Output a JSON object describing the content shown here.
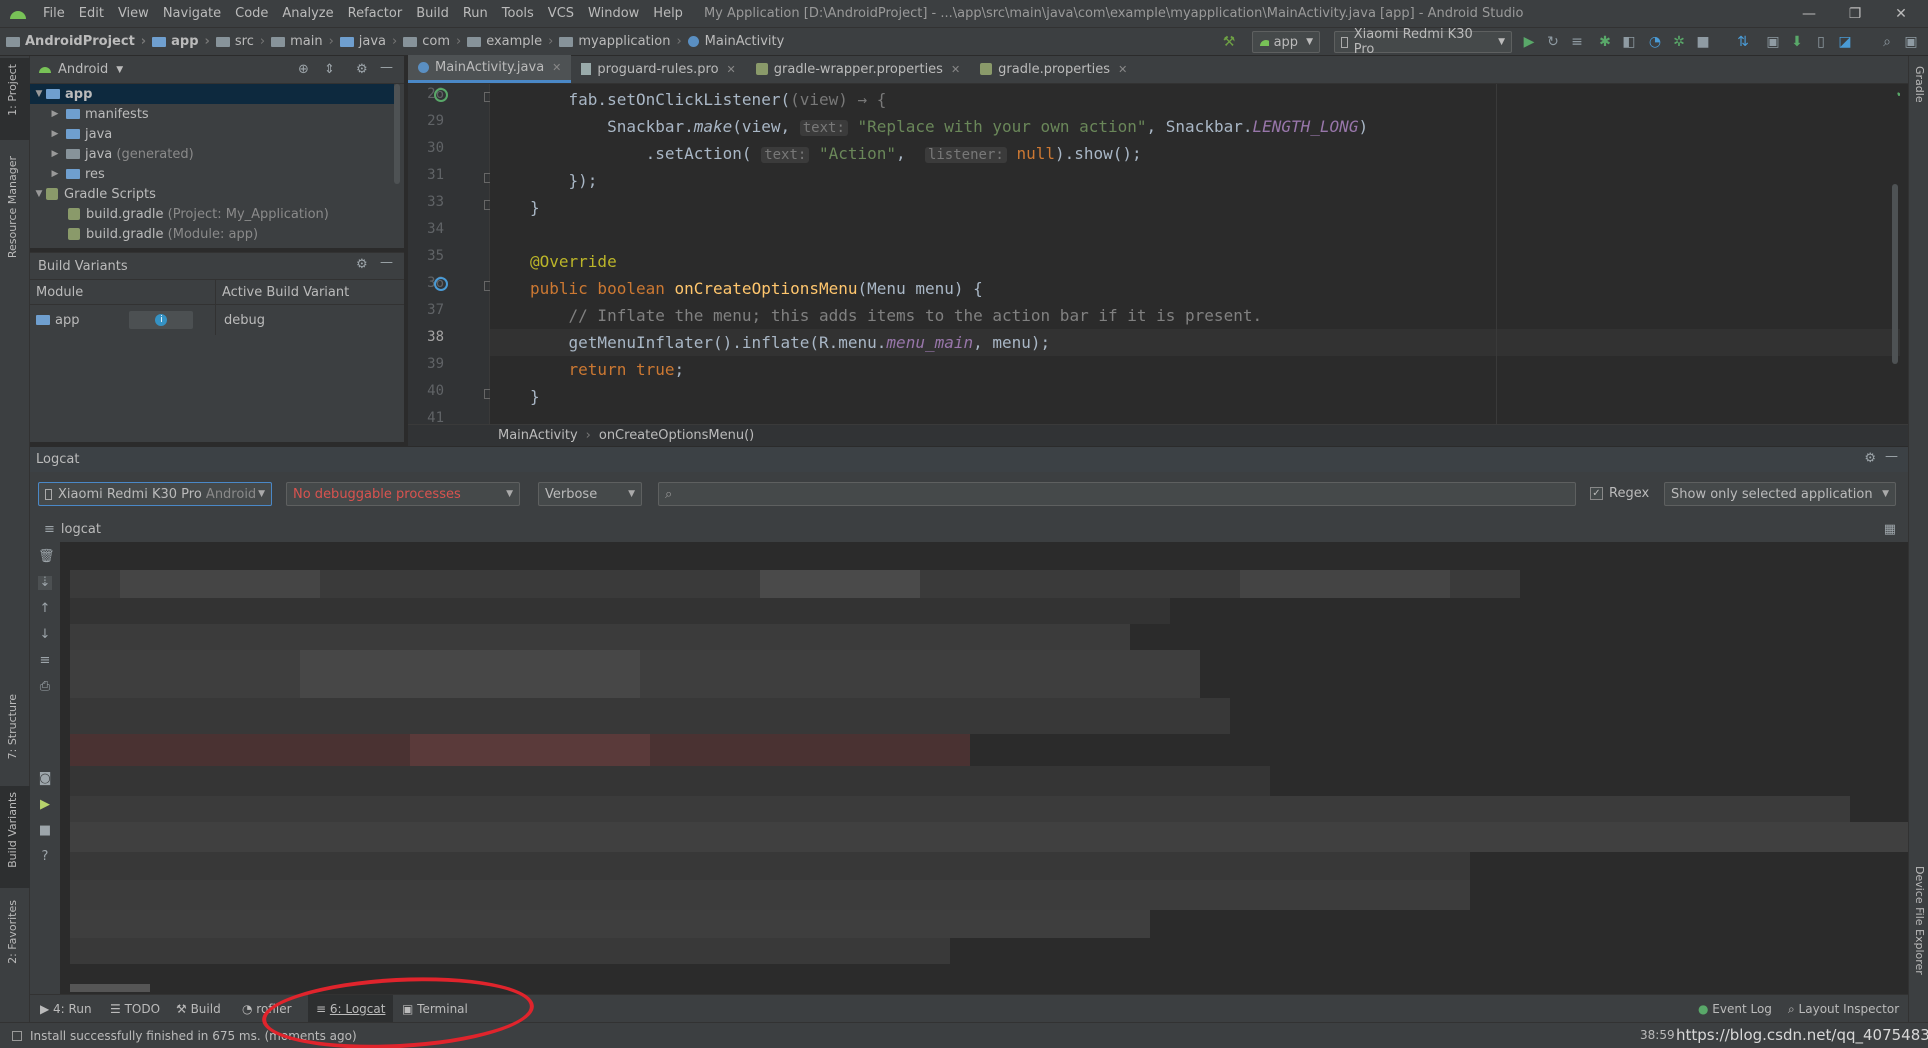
{
  "menubar": {
    "items": [
      "File",
      "Edit",
      "View",
      "Navigate",
      "Code",
      "Analyze",
      "Refactor",
      "Build",
      "Run",
      "Tools",
      "VCS",
      "Window",
      "Help"
    ],
    "window_title": "My Application [D:\\AndroidProject] - ...\\app\\src\\main\\java\\com\\example\\myapplication\\MainActivity.java [app] - Android Studio"
  },
  "navbar": {
    "breadcrumbs": [
      "AndroidProject",
      "app",
      "src",
      "main",
      "java",
      "com",
      "example",
      "myapplication",
      "MainActivity"
    ],
    "run_config": "app",
    "device": "Xiaomi Redmi K30 Pro"
  },
  "left_stripe": {
    "project": "1: Project",
    "resource_manager": "Resource Manager",
    "structure": "7: Structure",
    "build_variants": "Build Variants",
    "favorites": "2: Favorites"
  },
  "right_stripe": {
    "gradle": "Gradle",
    "device_file_explorer": "Device File Explorer"
  },
  "project_panel": {
    "view_mode": "Android",
    "tree": [
      {
        "label": "app",
        "note": ""
      },
      {
        "label": "manifests",
        "note": ""
      },
      {
        "label": "java",
        "note": ""
      },
      {
        "label": "java",
        "note": "(generated)"
      },
      {
        "label": "res",
        "note": ""
      },
      {
        "label": "Gradle Scripts",
        "note": ""
      },
      {
        "label": "build.gradle",
        "note": "(Project: My_Application)"
      },
      {
        "label": "build.gradle",
        "note": "(Module: app)"
      }
    ]
  },
  "build_variants": {
    "title": "Build Variants",
    "col_module": "Module",
    "col_variant": "Active Build Variant",
    "row_module": "app",
    "row_variant": "debug"
  },
  "editor": {
    "tabs": [
      "MainActivity.java",
      "proguard-rules.pro",
      "gradle-wrapper.properties",
      "gradle.properties"
    ],
    "line_numbers": [
      "26",
      "29",
      "30",
      "31",
      "33",
      "34",
      "35",
      "36",
      "37",
      "38",
      "39",
      "40",
      "41"
    ],
    "lines": {
      "l26_a": "    fab.setOnClickListener(",
      "l26_b": "(view) → {",
      "l29_a": "        Snackbar.",
      "l29_make": "make",
      "l29_b": "(view, ",
      "l29_hint": "text:",
      "l29_str": "\"Replace with your own action\"",
      "l29_c": ", Snackbar.",
      "l29_const": "LENGTH_LONG",
      "l29_d": ")",
      "l30_a": "            .setAction( ",
      "l30_hint1": "text:",
      "l30_str": "\"Action\"",
      "l30_b": ",  ",
      "l30_hint2": "listener:",
      "l30_null": "null",
      "l30_c": ").show();",
      "l31": "    });",
      "l33": "}",
      "l35": "@Override",
      "l36_kw": "public boolean ",
      "l36_fn": "onCreateOptionsMenu",
      "l36_rest": "(Menu menu) {",
      "l37": "    // Inflate the menu; this adds items to the action bar if it is present.",
      "l38_a": "    getMenuInflater().inflate(R.menu.",
      "l38_fld": "menu_main",
      "l38_b": ", menu);",
      "l39_kw": "    return true",
      "l39_b": ";",
      "l40": "}"
    },
    "breadcrumb_class": "MainActivity",
    "breadcrumb_method": "onCreateOptionsMenu()"
  },
  "logcat": {
    "title": "Logcat",
    "device": "Xiaomi Redmi K30 Pro",
    "device_os": "Android",
    "process": "No debuggable processes",
    "level": "Verbose",
    "search_placeholder": "",
    "regex_label": "Regex",
    "filter": "Show only selected application",
    "sub_tab": "logcat"
  },
  "bottom_tabs": {
    "run": "4: Run",
    "todo": "TODO",
    "build": "Build",
    "profiler": "rofiler",
    "logcat": "6: Logcat",
    "terminal": "Terminal",
    "event_log": "Event Log",
    "layout_inspector": "Layout Inspector"
  },
  "status": {
    "message": "Install successfully finished in 675 ms. (moments ago)",
    "position": "38:59",
    "watermark": "https://blog.csdn.net/qq_40754833"
  },
  "colors": {
    "accent": "#4a88c7",
    "annotation_circle": "#e0242c",
    "error_text": "#d9534f"
  }
}
